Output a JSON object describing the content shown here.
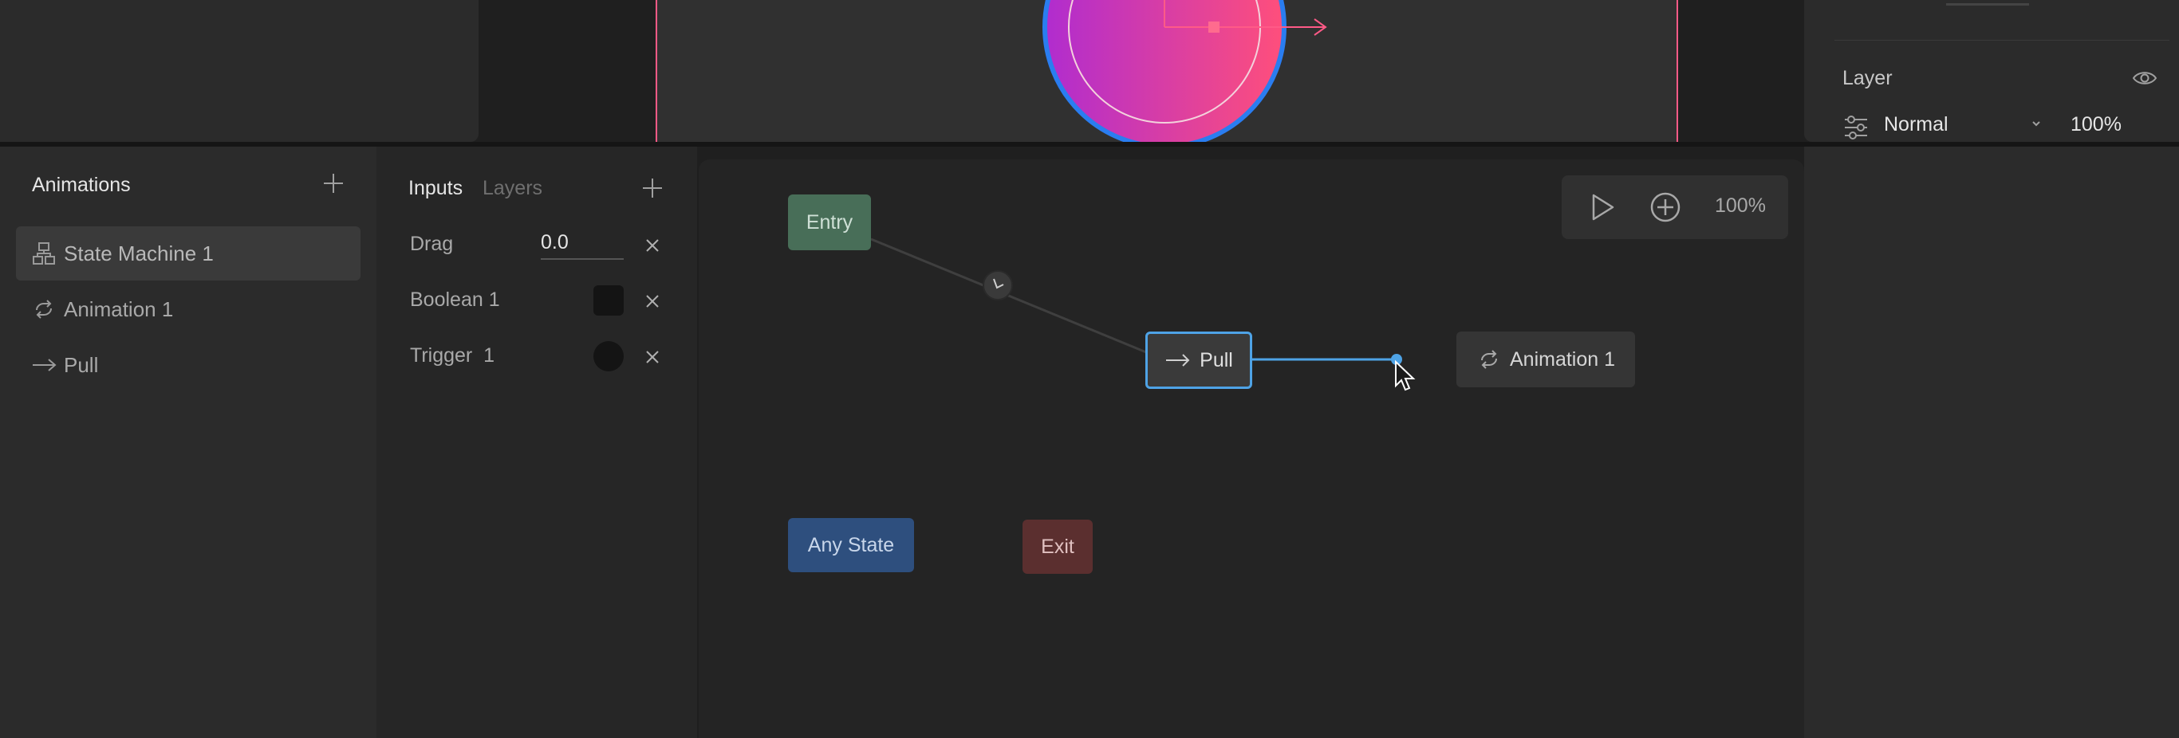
{
  "inspector": {
    "layer_label": "Layer",
    "blend_mode": "Normal",
    "opacity": "100%"
  },
  "animations": {
    "title": "Animations",
    "items": [
      {
        "label": "State Machine 1",
        "icon": "state-machine-icon",
        "selected": true
      },
      {
        "label": "Animation 1",
        "icon": "loop-icon",
        "selected": false
      },
      {
        "label": "Pull",
        "icon": "arrow-right-icon",
        "selected": false
      }
    ]
  },
  "inputs_panel": {
    "tab_inputs": "Inputs",
    "tab_layers": "Layers",
    "inputs": [
      {
        "label": "Drag",
        "value": "0.0",
        "type": "number"
      },
      {
        "label": "Boolean 1",
        "type": "boolean"
      },
      {
        "label": "Trigger  1",
        "type": "trigger"
      }
    ]
  },
  "graph": {
    "zoom": "100%",
    "nodes": {
      "entry": "Entry",
      "pull": "Pull",
      "animation": "Animation 1",
      "any_state": "Any State",
      "exit": "Exit"
    }
  },
  "colors": {
    "accent_blue": "#4ea3e6",
    "artboard_guide": "#ff5a87",
    "entry_node": "#486e58",
    "any_state_node": "#2e4f7e",
    "exit_node": "#5b2f2f"
  }
}
